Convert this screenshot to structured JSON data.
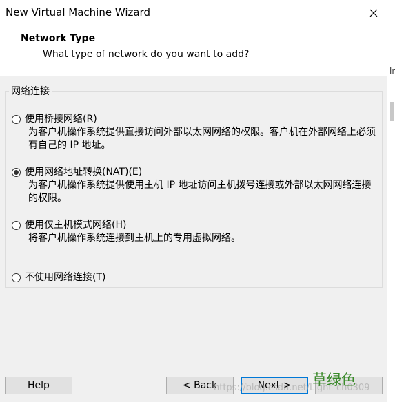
{
  "window": {
    "title": "New Virtual Machine Wizard"
  },
  "header": {
    "title": "Network Type",
    "subtitle": "What type of network do you want to add?"
  },
  "group": {
    "label": "网络连接",
    "options": [
      {
        "label": "使用桥接网络(R)",
        "desc": "为客户机操作系统提供直接访问外部以太网网络的权限。客户机在外部网络上必须有自己的 IP 地址。",
        "checked": false
      },
      {
        "label": "使用网络地址转换(NAT)(E)",
        "desc": "为客户机操作系统提供使用主机 IP 地址访问主机拨号连接或外部以太网网络连接的权限。",
        "checked": true
      },
      {
        "label": "使用仅主机模式网络(H)",
        "desc": "将客户机操作系统连接到主机上的专用虚拟网络。",
        "checked": false
      },
      {
        "label": "不使用网络连接(T)",
        "desc": "",
        "checked": false
      }
    ]
  },
  "buttons": {
    "help": "Help",
    "back": "< Back",
    "next": "Next >"
  },
  "overlay": {
    "watermark": "https://blog.csdn.net/Light_ch0309",
    "stamp": "草绿色",
    "behind_window_text": "lr"
  },
  "colors": {
    "accent": "#0078d7",
    "stamp": "#3a8a2a",
    "window_bg": "#f0f0f0"
  }
}
